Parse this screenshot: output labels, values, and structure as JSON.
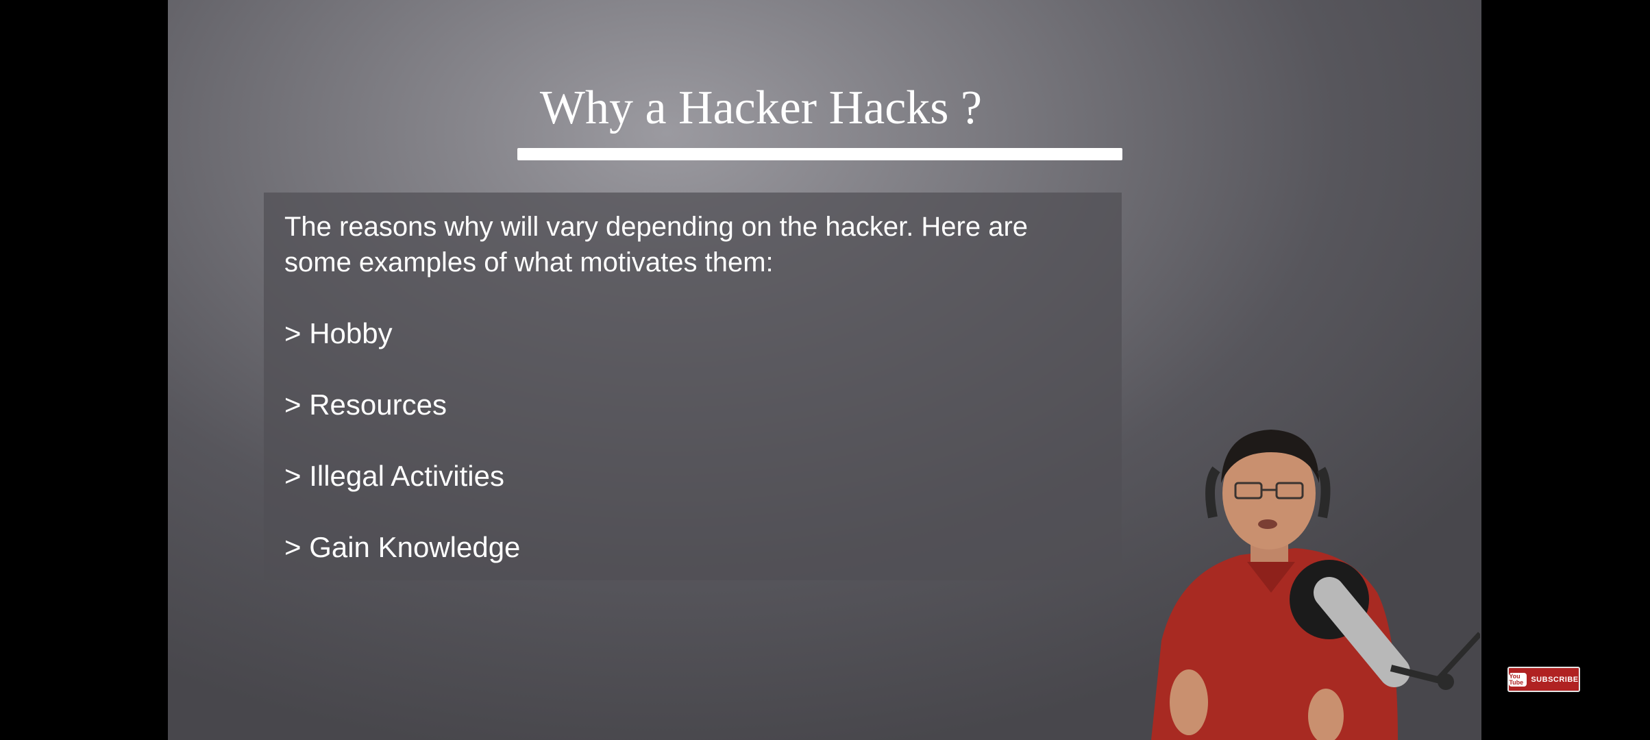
{
  "slide": {
    "title": "Why a Hacker Hacks ?",
    "intro": "The reasons why will vary depending on the hacker. Here are some examples of what motivates them:",
    "bullets": [
      "> Hobby",
      "> Resources",
      "> Illegal Activities",
      "> Gain Knowledge"
    ]
  },
  "overlay": {
    "subscribe_icon": "youtube-icon",
    "subscribe_label": "SUBSCRIBE",
    "logo_text": "You Tube"
  },
  "colors": {
    "background": "#000000",
    "slide_bg": "#6e6d73",
    "text": "#ffffff",
    "subscribe_red": "#b02222",
    "shirt_red": "#a82a22"
  }
}
